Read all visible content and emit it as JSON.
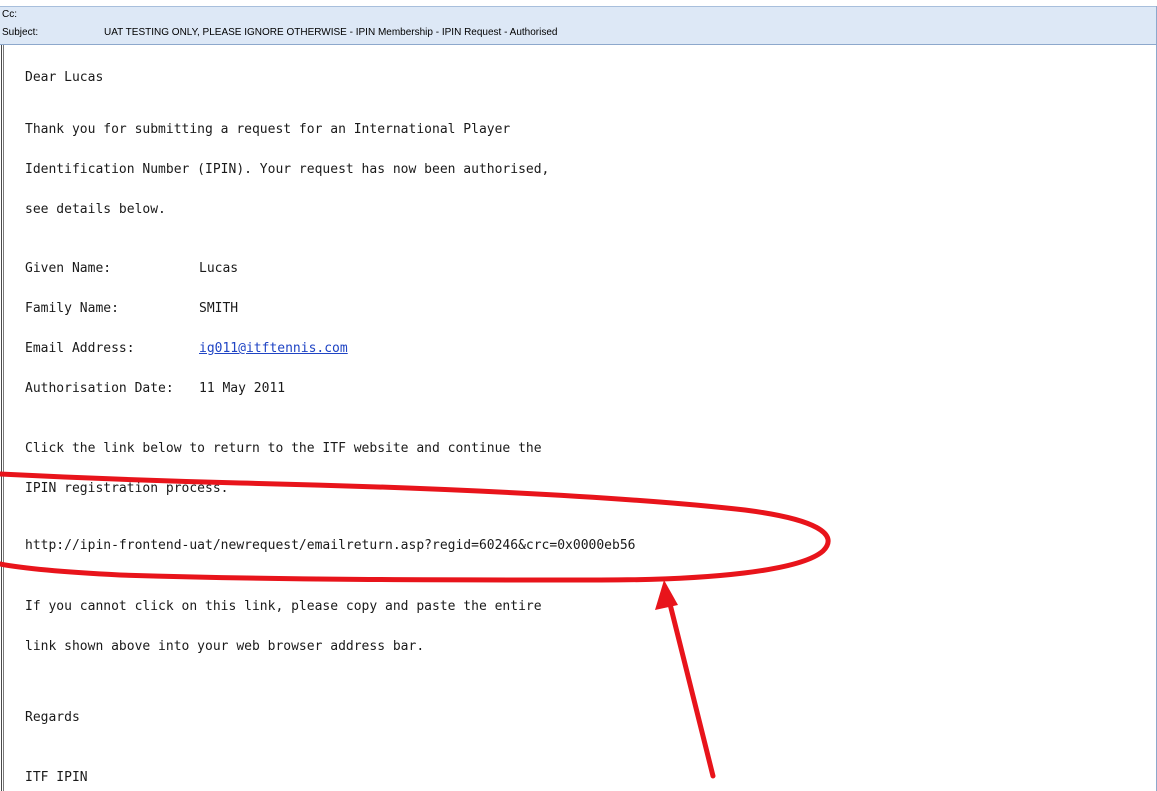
{
  "header": {
    "cc_label": "Cc:",
    "subject_label": "Subject:",
    "subject_value": "UAT TESTING ONLY, PLEASE IGNORE OTHERWISE - IPIN Membership - IPIN Request - Authorised"
  },
  "email": {
    "greeting": "Dear Lucas",
    "intro_lines": [
      "Thank you for submitting a request for an International Player",
      "Identification Number (IPIN). Your request has now been authorised,",
      "see details below."
    ],
    "details": [
      {
        "label": "Given Name:",
        "value": "Lucas"
      },
      {
        "label": "Family Name:",
        "value": "SMITH"
      },
      {
        "label": "Email Address:",
        "value": "ig011@itftennis.com"
      },
      {
        "label": "Authorisation Date:",
        "value": "11 May 2011"
      }
    ],
    "instruction_lines": [
      "Click the link below to return to the ITF website and continue the",
      "IPIN registration process."
    ],
    "return_url": "http://ipin-frontend-uat/newrequest/emailreturn.asp?regid=60246&crc=0x0000eb56",
    "fallback_lines": [
      "If you cannot click on this link, please copy and paste the entire",
      "link shown above into your web browser address bar."
    ],
    "signoff": "Regards",
    "signature": "ITF IPIN"
  },
  "annotation": {
    "color": "#e8141b"
  }
}
